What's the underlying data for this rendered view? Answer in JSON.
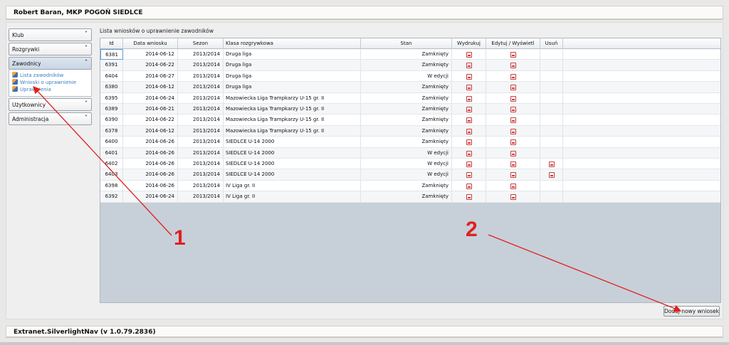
{
  "header": {
    "title": "Robert Baran, MKP POGOŃ SIEDLCE"
  },
  "sidebar": {
    "sections": [
      {
        "label": "Klub",
        "chevron": "˅"
      },
      {
        "label": "Rozgrywki",
        "chevron": "˅"
      },
      {
        "label": "Zawodnicy",
        "chevron": "˄"
      },
      {
        "label": "Użytkownicy",
        "chevron": "˅"
      },
      {
        "label": "Administracja",
        "chevron": "˅"
      }
    ],
    "subitems": [
      {
        "label": "Lista zawodników",
        "icon": "player-icon"
      },
      {
        "label": "Wnioski o uprawnienie",
        "icon": "player-icon"
      },
      {
        "label": "Uprawnienia",
        "icon": "player-icon"
      }
    ]
  },
  "main": {
    "title": "Lista wniosków o uprawnienie zawodników",
    "columns": [
      "Id",
      "Data wniosku",
      "Sezon",
      "Klasa rozgrywkowa",
      "Stan",
      "Wydrukuj",
      "Edytuj / Wyświetl",
      "Usuń"
    ],
    "rows": [
      {
        "id": "6381",
        "date": "2014-06-12",
        "season": "2013/2014",
        "class": "Druga liga",
        "state": "Zamknięty",
        "delete": false
      },
      {
        "id": "6391",
        "date": "2014-06-22",
        "season": "2013/2014",
        "class": "Druga liga",
        "state": "Zamknięty",
        "delete": false
      },
      {
        "id": "6404",
        "date": "2014-06-27",
        "season": "2013/2014",
        "class": "Druga liga",
        "state": "W edycji",
        "delete": false
      },
      {
        "id": "6380",
        "date": "2014-06-12",
        "season": "2013/2014",
        "class": "Druga liga",
        "state": "Zamknięty",
        "delete": false
      },
      {
        "id": "6395",
        "date": "2014-06-24",
        "season": "2013/2014",
        "class": "Mazowiecka Liga Trampkarzy U-15 gr. II",
        "state": "Zamknięty",
        "delete": false
      },
      {
        "id": "6389",
        "date": "2014-06-21",
        "season": "2013/2014",
        "class": "Mazowiecka Liga Trampkarzy U-15 gr. II",
        "state": "Zamknięty",
        "delete": false
      },
      {
        "id": "6390",
        "date": "2014-06-22",
        "season": "2013/2014",
        "class": "Mazowiecka Liga Trampkarzy U-15 gr. II",
        "state": "Zamknięty",
        "delete": false
      },
      {
        "id": "6378",
        "date": "2014-06-12",
        "season": "2013/2014",
        "class": "Mazowiecka Liga Trampkarzy U-15 gr. II",
        "state": "Zamknięty",
        "delete": false
      },
      {
        "id": "6400",
        "date": "2014-06-26",
        "season": "2013/2014",
        "class": "SIEDLCE U-14 2000",
        "state": "Zamknięty",
        "delete": false
      },
      {
        "id": "6401",
        "date": "2014-06-26",
        "season": "2013/2014",
        "class": "SIEDLCE U-14 2000",
        "state": "W edycji",
        "delete": false
      },
      {
        "id": "6402",
        "date": "2014-06-26",
        "season": "2013/2014",
        "class": "SIEDLCE U-14 2000",
        "state": "W edycji",
        "delete": true
      },
      {
        "id": "6403",
        "date": "2014-06-26",
        "season": "2013/2014",
        "class": "SIEDLCE U-14 2000",
        "state": "W edycji",
        "delete": true
      },
      {
        "id": "6398",
        "date": "2014-06-26",
        "season": "2013/2014",
        "class": "IV Liga gr. II",
        "state": "Zamknięty",
        "delete": false
      },
      {
        "id": "6392",
        "date": "2014-06-24",
        "season": "2013/2014",
        "class": "IV Liga gr. II",
        "state": "Zamknięty",
        "delete": false
      }
    ],
    "add_button": "Dodaj nowy wniosek"
  },
  "annotations": {
    "one": "1",
    "two": "2",
    "color": "#e02020"
  },
  "footer": {
    "text": "Extranet.SilverlightNav (v 1.0.79.2836)"
  }
}
